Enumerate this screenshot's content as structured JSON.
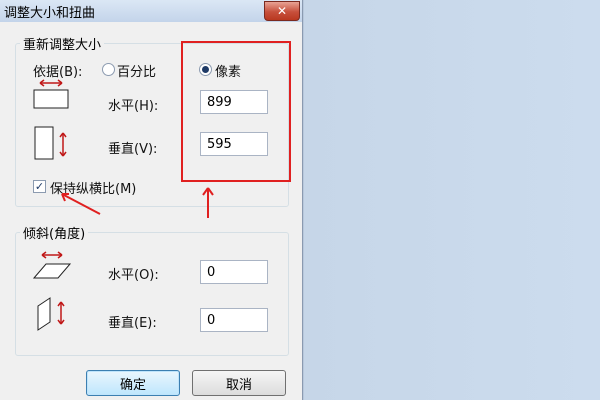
{
  "dialog": {
    "title": "调整大小和扭曲",
    "close_symbol": "✕"
  },
  "resize": {
    "group_title": "重新调整大小",
    "by_label": "依据(B):",
    "percent_label": "百分比",
    "pixels_label": "像素",
    "selected_unit": "像素",
    "horizontal_label": "水平(H):",
    "horizontal_value": "899",
    "vertical_label": "垂直(V):",
    "vertical_value": "595",
    "keep_ratio_label": "保持纵横比(M)",
    "keep_ratio_checked": true
  },
  "skew": {
    "group_title": "倾斜(角度)",
    "horizontal_label": "水平(O):",
    "horizontal_value": "0",
    "vertical_label": "垂直(E):",
    "vertical_value": "0"
  },
  "buttons": {
    "ok": "确定",
    "cancel": "取消"
  },
  "icons": {
    "resize_horizontal": "resize-horizontal-icon",
    "resize_vertical": "resize-vertical-icon",
    "skew_horizontal": "skew-horizontal-icon",
    "skew_vertical": "skew-vertical-icon",
    "annotation_arrows": "red-arrow-icon"
  },
  "colors": {
    "annotation": "#e02020",
    "icon_arrow": "#c01818",
    "background_right": "#c9d9eb"
  }
}
